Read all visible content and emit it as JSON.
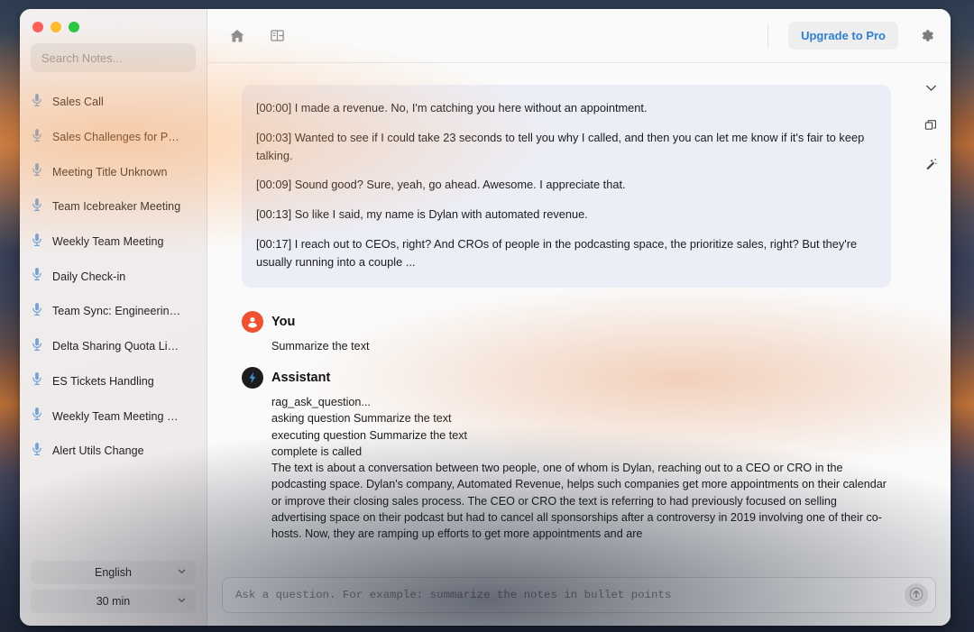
{
  "window": {
    "traffic_lights": [
      {
        "name": "close",
        "color": "#ff5f57"
      },
      {
        "name": "minimize",
        "color": "#febc2e"
      },
      {
        "name": "maximize",
        "color": "#28c840"
      }
    ]
  },
  "sidebar": {
    "search": {
      "placeholder": "Search Notes..."
    },
    "notes": [
      {
        "label": "Sales Call"
      },
      {
        "label": "Sales Challenges for P…"
      },
      {
        "label": "Meeting Title Unknown"
      },
      {
        "label": "Team Icebreaker Meeting"
      },
      {
        "label": "Weekly Team Meeting"
      },
      {
        "label": "Daily Check-in"
      },
      {
        "label": "Team Sync: Engineerin…"
      },
      {
        "label": "Delta Sharing Quota Li…"
      },
      {
        "label": "ES Tickets Handling"
      },
      {
        "label": "Weekly Team Meeting …"
      },
      {
        "label": "Alert Utils Change"
      }
    ],
    "language_select": {
      "value": "English"
    },
    "duration_select": {
      "value": "30 min"
    }
  },
  "toolbar": {
    "home_icon": "home-icon",
    "layout_icon": "panel-layout-icon",
    "upgrade_label": "Upgrade to Pro",
    "settings_icon": "gear-icon",
    "accent_color": "#2f7fd6"
  },
  "rail": {
    "items": [
      {
        "icon": "chevron-down-icon"
      },
      {
        "icon": "copy-icon"
      },
      {
        "icon": "magic-wand-icon"
      }
    ]
  },
  "transcript": {
    "background": "#eceef7",
    "lines": [
      "[00:00] I made a revenue. No, I'm catching you here without an appointment.",
      "[00:03] Wanted to see if I could take 23 seconds to tell you why I called, and then you can let me know if it's fair to keep talking.",
      "[00:09] Sound good? Sure, yeah, go ahead. Awesome. I appreciate that.",
      "[00:13] So like I said, my name is Dylan with automated revenue.",
      "[00:17] I reach out to CEOs, right? And CROs of people in the podcasting space, the prioritize sales, right? But they're usually running into a couple ..."
    ]
  },
  "messages": [
    {
      "author": "You",
      "avatar_icon": "user-avatar-icon",
      "avatar_color": "#f1502f",
      "text": "Summarize the text"
    },
    {
      "author": "Assistant",
      "avatar_icon": "lightning-bolt-icon",
      "avatar_color": "#1c1c1c",
      "log_lines": [
        "rag_ask_question...",
        "asking question Summarize the text",
        "executing question Summarize the text",
        "complete is called"
      ],
      "text": "The text is about a conversation between two people, one of whom is Dylan, reaching out to a CEO or CRO in the podcasting space. Dylan's company, Automated Revenue, helps such companies get more appointments on their calendar or improve their closing sales process. The CEO or CRO the text is referring to had previously focused on selling advertising space on their podcast but had to cancel all sponsorships after a controversy in 2019 involving one of their co-hosts. Now, they are ramping up efforts to get more appointments and are"
    }
  ],
  "scroll_fab": {
    "icon": "arrow-down-icon"
  },
  "composer": {
    "placeholder": "Ask a question. For example: summarize the notes in bullet points",
    "value": "",
    "send_icon": "arrow-up-icon"
  }
}
